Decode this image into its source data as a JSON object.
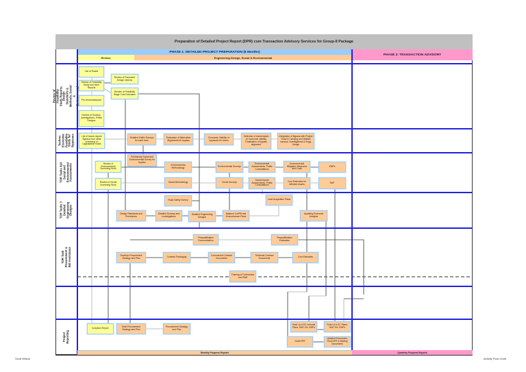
{
  "title": "Preparation of Detailed Project Report (DPR) cum Transaction Advisory Services for Group-II Package",
  "phase1": {
    "label": "PHASE 1: DETAILED PROJECT PREPARATION (6 Months)",
    "review_label": "Review",
    "engineering_label": "Engineering Design, Social & Environmental"
  },
  "phase2": {
    "label": "PHASE 2: TRANSACTION ADVISORY"
  },
  "lanes": [
    "Review of Feasibility Study Reports, Design Standards & Methods, Social & Environmental",
    "Techno-Economic Feasibility Study for Bypasses",
    "TOR Tasks 3&5 Social and Environmental Assessments",
    "TOR Tasks 3 Detailed Engineering Designs",
    "TOR Task Procurement & Bid Assistance",
    "",
    "Project Reporting"
  ],
  "nodes": [
    {
      "id": "list_roads",
      "label": "List of Roads",
      "color": "yellow"
    },
    {
      "id": "review_fs",
      "label": "Review of Feasibility Study and other Reports",
      "color": "yellow"
    },
    {
      "id": "prerecon",
      "label": "Pre-reconnaissance",
      "color": "yellow"
    },
    {
      "id": "review_surveys",
      "label": "Review of Surveys, Investigations, Prelim Designs",
      "color": "yellow"
    },
    {
      "id": "pavement",
      "label": "Review of Pavement Design Options",
      "color": "yellow"
    },
    {
      "id": "fs_cost",
      "label": "Review of Feasibility Stage Cost Estimates",
      "color": "yellow"
    },
    {
      "id": "towns_bypass",
      "label": "List of towns require Bypass from initial screening on Upgradation roads",
      "color": "yellow"
    },
    {
      "id": "traffic",
      "label": "Detailed Traffic Surveys for each town",
      "color": "orange"
    },
    {
      "id": "alt_align",
      "label": "Evaluation of Alternative Alignments for bypass",
      "color": "orange"
    },
    {
      "id": "econ_viab",
      "label": "Economic Viability of bypasses for towns",
      "color": "orange"
    },
    {
      "id": "selection",
      "label": "Selection of towns based on economic viability, Finalisation of bypass alignment",
      "color": "orange"
    },
    {
      "id": "integration",
      "label": "Integration of Bypass with Project Road & Carrying out Detailed surveys, investigations & Engg. Design",
      "color": "orange"
    },
    {
      "id": "prelim_se",
      "label": "Preliminary Social and Environmental Survey for bypass",
      "color": "orange"
    },
    {
      "id": "rev_env",
      "label": "Review of Environmental Screening Work",
      "color": "yellow"
    },
    {
      "id": "rev_soc",
      "label": "Review of Social Screening Work",
      "color": "yellow"
    },
    {
      "id": "env_meth",
      "label": "Environmental Methodology",
      "color": "orange"
    },
    {
      "id": "soc_meth",
      "label": "Social Methodology",
      "color": "orange"
    },
    {
      "id": "env_surv",
      "label": "Environmental Surveys",
      "color": "orange"
    },
    {
      "id": "soc_surv",
      "label": "Social Surveys",
      "color": "orange"
    },
    {
      "id": "env_assess",
      "label": "Environmental Assessments, Public Consultations",
      "color": "orange"
    },
    {
      "id": "soc_assess",
      "label": "Social Impact Assessments, Public Consultations",
      "color": "orange"
    },
    {
      "id": "env_mitig",
      "label": "Environmental Mitigation Measures and Costs",
      "color": "orange"
    },
    {
      "id": "cost_assets",
      "label": "Cost Estimates for Affected Assets",
      "color": "orange"
    },
    {
      "id": "emps",
      "label": "EMPs",
      "color": "orange"
    },
    {
      "id": "rap",
      "label": "RAP",
      "color": "orange"
    },
    {
      "id": "road_safety",
      "label": "Road Safety Survey",
      "color": "orange"
    },
    {
      "id": "design_std",
      "label": "Design Standards and Procedures",
      "color": "orange"
    },
    {
      "id": "det_surveys",
      "label": "Detailed Surveys and Investigations",
      "color": "orange"
    },
    {
      "id": "det_eng",
      "label": "Detailed Engineering Designs",
      "color": "orange"
    },
    {
      "id": "cutfill",
      "label": "Balance Cut/Fill and Encumbrance Plans",
      "color": "orange"
    },
    {
      "id": "land_acq",
      "label": "Land Acquisition Plans",
      "color": "orange"
    },
    {
      "id": "upd_econ",
      "label": "Updating Economic Analysis",
      "color": "orange"
    },
    {
      "id": "preq_doc",
      "label": "Prequalification Documentation",
      "color": "orange"
    },
    {
      "id": "preq_eval",
      "label": "Prequalification Evaluation",
      "color": "orange"
    },
    {
      "id": "dev_proc",
      "label": "Develop Procurement Strategy and Plan",
      "color": "orange"
    },
    {
      "id": "packaging",
      "label": "Contract Packaging",
      "color": "orange"
    },
    {
      "id": "comm_docs",
      "label": "Commercial Contract Documents",
      "color": "orange"
    },
    {
      "id": "tech_docs",
      "label": "Technical Contract Documents",
      "color": "orange"
    },
    {
      "id": "cost_est",
      "label": "Cost Estimates",
      "color": "orange"
    },
    {
      "id": "training",
      "label": "Training of Contractors and Staff",
      "color": "orange"
    },
    {
      "id": "inception",
      "label": "Inception Report",
      "color": "yellow"
    },
    {
      "id": "draft_proc",
      "label": "Draft Procurement Strategy and Plan",
      "color": "orange"
    },
    {
      "id": "proc_plan",
      "label": "Procurement Strategy and Plan",
      "color": "orange"
    },
    {
      "id": "draft_la",
      "label": "Draft LA & EC removal Plans, RAP, EA, EMPs",
      "color": "orange"
    },
    {
      "id": "final_la",
      "label": "Final LA & EC Plans, RAP, EA, EMPs",
      "color": "orange"
    },
    {
      "id": "draft_dpr",
      "label": "Draft DPR",
      "color": "orange"
    },
    {
      "id": "final_dpr",
      "label": "Updated Economics, Final DPR & Bidding Documents",
      "color": "orange"
    }
  ],
  "bars": {
    "monthly": "Monthly Progress Reports",
    "quarterly": "Quarterly Progress Reports"
  },
  "footer": {
    "left": "Scott Wilson",
    "right": "Activity Flow Chart"
  }
}
